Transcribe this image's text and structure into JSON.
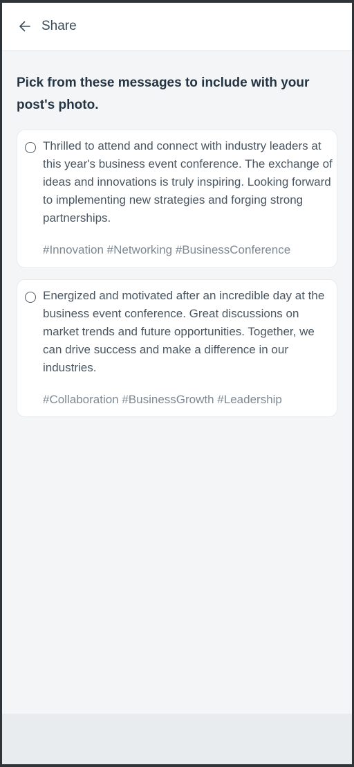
{
  "header": {
    "title": "Share",
    "back_icon": "arrow-left-icon"
  },
  "prompt": "Pick from these messages to include with your post's photo.",
  "options": [
    {
      "message": "Thrilled to attend and connect with industry leaders at this year's business event conference. The exchange of ideas and innovations is truly inspiring. Looking forward to implementing new strategies and forging strong partnerships.",
      "hashtags": "#Innovation #Networking #BusinessConference",
      "selected": false
    },
    {
      "message": "Energized and motivated after an incredible day at the business event conference. Great discussions on market trends and future opportunities. Together, we can drive success and make a difference in our industries.",
      "hashtags": "#Collaboration #BusinessGrowth #Leadership",
      "selected": false
    }
  ],
  "colors": {
    "background": "#f3f5f7",
    "card": "#ffffff",
    "text": "#4a5763",
    "heading": "#243443",
    "hashtag": "#7d8893"
  }
}
